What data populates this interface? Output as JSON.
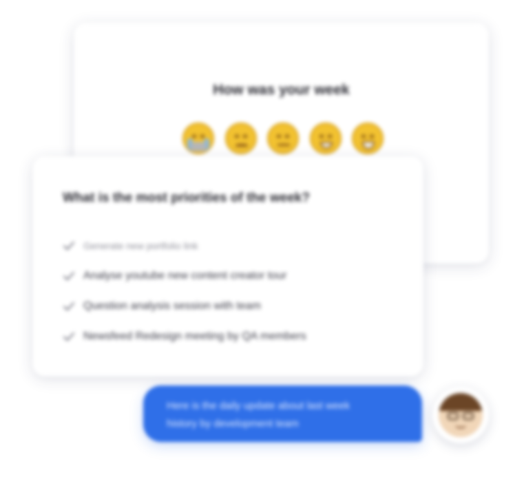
{
  "mood_card": {
    "title": "How was your week",
    "emojis": [
      {
        "icon": "crying-face-icon"
      },
      {
        "icon": "frowning-face-icon"
      },
      {
        "icon": "neutral-face-icon"
      },
      {
        "icon": "grinning-face-icon"
      },
      {
        "icon": "smiling-face-icon"
      }
    ]
  },
  "priorities_card": {
    "title": "What is the most priorities of the week?",
    "tasks": [
      {
        "label": "Generate new portfolio link",
        "icon": "check-icon"
      },
      {
        "label": "Analyse youtube new content creator tour",
        "icon": "check-icon"
      },
      {
        "label": "Question analysis session with team",
        "icon": "check-icon"
      },
      {
        "label": "Newsfeed Redesign meeting by QA members",
        "icon": "check-icon"
      }
    ]
  },
  "chat": {
    "message_line1": "Here is the daily update about last week",
    "message_line2": "history by development team",
    "avatar_icon": "user-avatar"
  },
  "colors": {
    "bubble": "#2f6fe8",
    "emoji": "#f2c230",
    "check": "#6b6b78"
  }
}
